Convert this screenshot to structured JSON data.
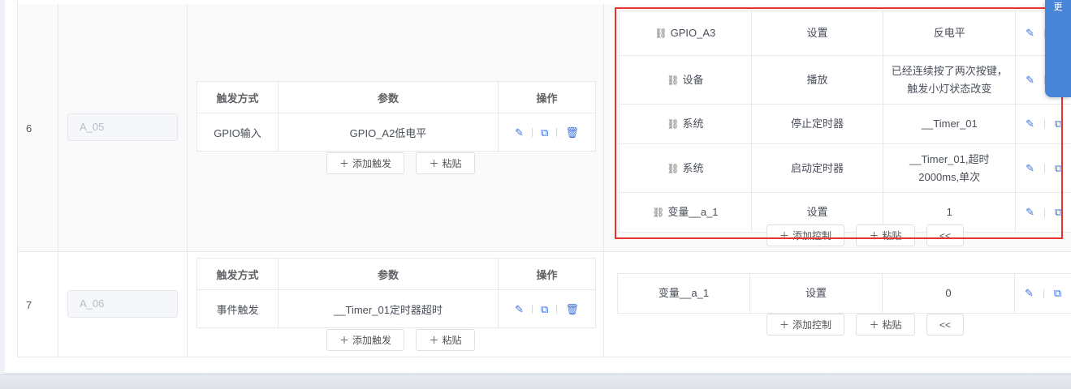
{
  "rows": [
    {
      "index": "6",
      "name": "A_05",
      "trigger_table": {
        "headers": [
          "触发方式",
          "参数",
          "操作"
        ],
        "rows": [
          {
            "method": "GPIO输入",
            "param": "GPIO_A2低电平"
          }
        ]
      },
      "controls": [
        {
          "target": "GPIO_A3",
          "action": "设置",
          "value": "反电平"
        },
        {
          "target": "设备",
          "action": "播放",
          "value": "已经连续按了两次按键，触发小灯状态改变"
        },
        {
          "target": "系统",
          "action": "停止定时器",
          "value": "__Timer_01"
        },
        {
          "target": "系统",
          "action": "启动定时器",
          "value": "__Timer_01,超时2000ms,单次"
        },
        {
          "target": "变量__a_1",
          "action": "设置",
          "value": "1"
        }
      ]
    },
    {
      "index": "7",
      "name": "A_06",
      "trigger_table": {
        "headers": [
          "触发方式",
          "参数",
          "操作"
        ],
        "rows": [
          {
            "method": "事件触发",
            "param": "__Timer_01定时器超时"
          }
        ]
      },
      "controls": [
        {
          "target": "变量__a_1",
          "action": "设置",
          "value": "0"
        }
      ]
    }
  ],
  "buttons": {
    "add_trigger": "添加触发",
    "paste": "粘贴",
    "add_control": "添加控制",
    "collapse": "<<"
  },
  "side_button": {
    "label": "更"
  },
  "icons": {
    "edit": "pencil-icon",
    "copy": "copy-icon",
    "delete": "trash-icon",
    "link": "link-icon",
    "plus": "plus-icon"
  },
  "colors": {
    "accent": "#3b6fd8",
    "highlight_box": "#e8322c",
    "side_button": "#4a86d8"
  }
}
